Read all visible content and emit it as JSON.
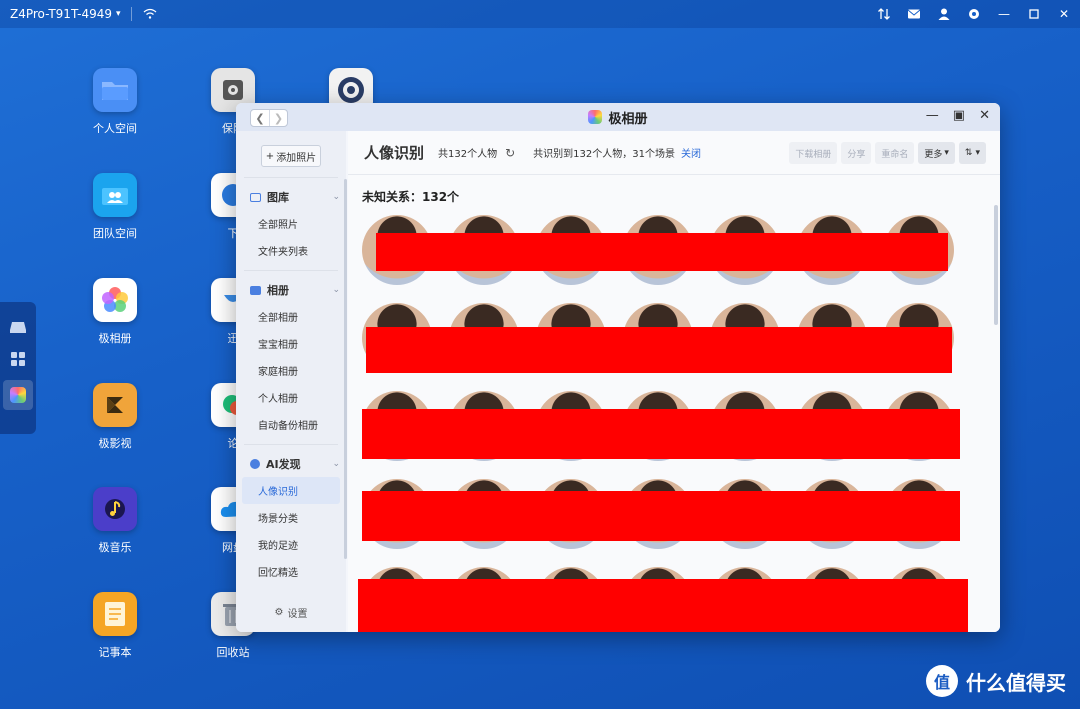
{
  "topbar": {
    "device_name": "Z4Pro-T91T-4949"
  },
  "desktop": {
    "col1": [
      {
        "label": "个人空间",
        "icon": "folder-icon",
        "color": "#3b82f6"
      },
      {
        "label": "团队空间",
        "icon": "team-folder-icon",
        "color": "#19a7f0"
      },
      {
        "label": "极相册",
        "icon": "photos-icon",
        "color": "#ffffff"
      },
      {
        "label": "极影视",
        "icon": "video-icon",
        "color": "#f2a23a"
      },
      {
        "label": "极音乐",
        "icon": "music-icon",
        "color": "#5b4bd6"
      },
      {
        "label": "记事本",
        "icon": "notes-icon",
        "color": "#f5a524"
      }
    ],
    "col2": [
      {
        "label": "保险",
        "icon": "safe-icon",
        "color": "#e9e9e9"
      },
      {
        "label": "下",
        "icon": "download-icon",
        "color": "#ffffff"
      },
      {
        "label": "迅",
        "icon": "xunlei-icon",
        "color": "#ffffff"
      },
      {
        "label": "论",
        "icon": "forum-icon",
        "color": "#ffffff"
      },
      {
        "label": "网盘",
        "icon": "cloud-icon",
        "color": "#ffffff"
      },
      {
        "label": "回收站",
        "icon": "trash-icon",
        "color": "#eeeeee"
      }
    ]
  },
  "window": {
    "title": "极相册",
    "add_photo": "添加照片",
    "sidebar": {
      "gallery": {
        "label": "图库",
        "items": [
          "全部照片",
          "文件夹列表"
        ]
      },
      "albums": {
        "label": "相册",
        "items": [
          "全部相册",
          "宝宝相册",
          "家庭相册",
          "个人相册",
          "自动备份相册"
        ]
      },
      "ai": {
        "label": "AI发现",
        "items": [
          "人像识别",
          "场景分类",
          "我的足迹",
          "回忆精选"
        ]
      },
      "settings": "设置"
    },
    "main": {
      "title": "人像识别",
      "count": "共132个人物",
      "recognized": "共识别到132个人物，31个场景",
      "close_link": "关闭",
      "toolbar": {
        "download": "下载相册",
        "share": "分享",
        "rename": "重命名",
        "more": "更多"
      },
      "section": "未知关系：132个"
    }
  },
  "watermark": {
    "logo": "值",
    "text": "什么值得买"
  },
  "colors": {
    "accent": "#2a6ad8",
    "redaction": "#ff0000",
    "desktop_bg": "#1760c8"
  }
}
